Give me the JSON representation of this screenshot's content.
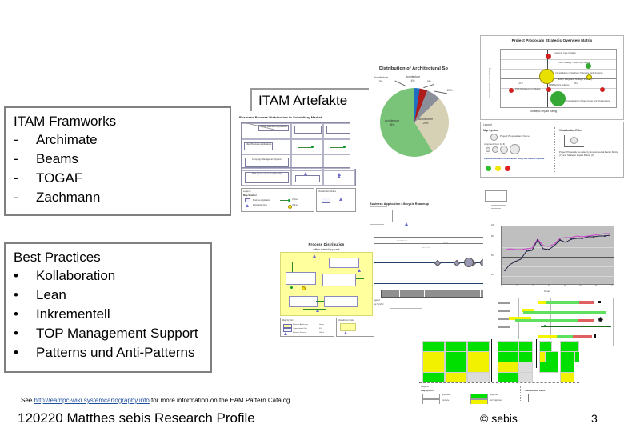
{
  "slide": {
    "page_number": "3",
    "footer_title": "120220 Matthes sebis Research Profile",
    "copyright": "© sebis",
    "source_note_prefix": "See ",
    "source_note_link": "http://eampc-wiki.systemcartography.info",
    "source_note_suffix": " for more information on the EAM Pattern Catalog"
  },
  "artefakte_header": {
    "title": "ITAM Artefakte"
  },
  "frameworks_box": {
    "title": "ITAM Framworks",
    "bullet": "-",
    "items": [
      {
        "bullet": "-",
        "label": "Archimate"
      },
      {
        "bullet": "-",
        "label": "Beams"
      },
      {
        "bullet": "-",
        "label": "TOGAF"
      },
      {
        "bullet": "-",
        "label": "Zachmann"
      }
    ]
  },
  "practices_box": {
    "title": "Best Practices",
    "items": [
      {
        "bullet": "•",
        "label": "Kollaboration"
      },
      {
        "bullet": "•",
        "label": "Lean"
      },
      {
        "bullet": "•",
        "label": "Inkrementell"
      },
      {
        "bullet": "•",
        "label": "TOP Management Support"
      },
      {
        "bullet": "•",
        "label": "Patterns und Anti-Patterns"
      }
    ]
  },
  "figures": {
    "cluster_map": {
      "title": "Business Process Distribution in Subsidiary Market",
      "legend_title": "Legend",
      "legend_sections": [
        "Map Symbol",
        "Visualization Rules"
      ],
      "cells": [
        "Server Business Applications",
        "Client Business Applications",
        "Campaign Management System",
        "Customer Complaint System",
        "POS System (Germany/Munich)"
      ],
      "legend_items": [
        "Business Application",
        "Information Flow",
        "Interface"
      ],
      "legend_right": [
        "Type of Interface",
        "Online",
        "Offline"
      ]
    },
    "pie_chart": {
      "title": "Distribution of Architectural So",
      "slices": [
        {
          "label": "Architecture",
          "percent": "3%",
          "color": "#1f6fc4"
        },
        {
          "label": "Architecture",
          "percent": "4%",
          "color": "#b01c1c"
        },
        {
          "label": "Architecture",
          "percent": "6%",
          "color": "#8a8f99"
        },
        {
          "label": "Architecture",
          "percent": "29%",
          "color": "#d6d0b4"
        },
        {
          "label": "Architecture",
          "percent": "58%",
          "color": "#7ac47a"
        }
      ]
    },
    "strategic_matrix": {
      "title": "Project Proposals Strategic Overview Matrix",
      "ylabel": "Environmental Factor Rating",
      "xlabel": "Strategic Impact Rating",
      "x_left_tick": "-5.0",
      "x_right_tick": "5.0",
      "bubbles": [
        {
          "color": "red",
          "note": "Customer Care Initiative"
        },
        {
          "color": "green",
          "note": "CRM Strategy / Reporting Funding"
        },
        {
          "color": "yellow",
          "note": "Consolidation of Southern IT Service Desk Systems"
        },
        {
          "color": "yellow",
          "note": "EAM / Integration Strategic Inventory"
        },
        {
          "color": "red",
          "note": "POS Replacement Initiative"
        },
        {
          "color": "red",
          "note": "CRM Service Initiative"
        },
        {
          "color": "green",
          "note": "Consolidation of Data Center and Infrastructure"
        },
        {
          "color": "red",
          "note": "Integration of Virtualization and Cloud"
        }
      ]
    },
    "legend_panel": {
      "title": "Legend",
      "left_heading": "Map Symbol",
      "left_item": "Project Proposal and Name",
      "sizing_label": "Alignment Cost (in €)",
      "sizing_ticks": [
        "<1.000",
        "100.000",
        "1.000.000"
      ],
      "rating_label": "Expected Return of Investment (ROI) of Project Proposal",
      "right_heading": "Visualization Rules",
      "right_text": "Project Proposals are rated by Environmental Factor Rating (Y) and Strategic Impact Rating (X)"
    },
    "roadmap": {
      "title": "Business Application Lifecycle Roadmap",
      "legend_title": "Legend",
      "legend_items": [
        "Map Symbol",
        "Visualization Rules"
      ]
    },
    "process_support": {
      "title": "Process Distribution",
      "subtitle": "within subsidiary bank",
      "legend_title": "Legend",
      "legend_heading": "Map Symbol",
      "legend_items": [
        "Business Application",
        "Organizational Unit",
        "Business Process",
        "Information Flow"
      ],
      "legend_right_items": [
        "Group",
        "IFG",
        "Offline"
      ],
      "rules_title": "Visualization Rules"
    },
    "line_chart": {
      "xlabel": "Count",
      "legend_items": [
        "Standard",
        "Baseline 1",
        "Baseline 2"
      ],
      "y_ticks": [
        "100",
        "90",
        "80",
        "70",
        "60",
        "50",
        "40",
        "30",
        "20",
        "10"
      ],
      "x_ticks": [
        "01",
        "02",
        "03",
        "04",
        "05",
        "06",
        "07",
        "08",
        "09",
        "10",
        "11",
        "12",
        "13",
        "14",
        "15",
        "16",
        "17",
        "18",
        "19",
        "20",
        "21",
        "22"
      ]
    },
    "gantt": {
      "bars": [
        {
          "green": 46,
          "yellow": 8,
          "red": 18
        },
        {
          "green": 70,
          "yellow": 12,
          "red": 0
        },
        {
          "green": 58,
          "yellow": 22,
          "red": 14
        },
        {
          "green": 62,
          "yellow": 0,
          "red": 0
        },
        {
          "green": 34,
          "yellow": 14,
          "red": 20
        }
      ]
    },
    "tile_matrix": {
      "legend_title": "Legend",
      "legend_heading": "Map Symbol",
      "legend_items": [
        "Application",
        "Interface",
        "Supported",
        "Not Supported"
      ],
      "rules_title": "Visualization Rules"
    }
  },
  "colors": {
    "border_gray": "#808080",
    "link_blue": "#1f4e9c",
    "green": "#00e000",
    "yellow": "#f2f200",
    "red": "#d02020",
    "pie_green": "#7ac47a",
    "pie_beige": "#d6d0b4"
  }
}
